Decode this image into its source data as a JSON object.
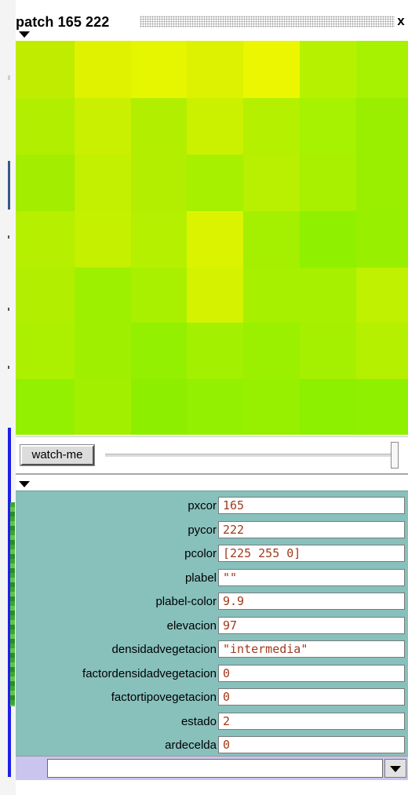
{
  "window": {
    "title": "patch 165 222",
    "close_symbol": "x",
    "icons": {
      "close": "close-icon",
      "view_toggle": "triangle-down-icon",
      "details_toggle": "triangle-down-icon",
      "dropdown": "chevron-down-icon"
    }
  },
  "view": {
    "patch_colors": [
      [
        "#c0ec00",
        "#e1f200",
        "#e6f500",
        "#ddf200",
        "#ecf600",
        "#b6f200",
        "#a6f200"
      ],
      [
        "#b2ee00",
        "#c9f000",
        "#b2ee00",
        "#cbf000",
        "#b5f000",
        "#a6f200",
        "#9aee00"
      ],
      [
        "#a2ed00",
        "#c3ef00",
        "#b3ee00",
        "#a6f000",
        "#b9ef00",
        "#a9f000",
        "#9aee00"
      ],
      [
        "#b6ef00",
        "#c5f000",
        "#b4f000",
        "#dcf300",
        "#a4f000",
        "#8ff000",
        "#98f000"
      ],
      [
        "#b1ee00",
        "#9df000",
        "#a9f000",
        "#d5f200",
        "#a6f000",
        "#a6f000",
        "#bff100"
      ],
      [
        "#acf000",
        "#9ef000",
        "#93f000",
        "#a3f000",
        "#9bf000",
        "#a4f000",
        "#b4f000"
      ],
      [
        "#93f000",
        "#a2f000",
        "#8eee00",
        "#92f000",
        "#97f000",
        "#8cf000",
        "#8ff000"
      ]
    ]
  },
  "controls": {
    "watch_me_label": "watch-me",
    "speed_value": 1.0
  },
  "variables": [
    {
      "name": "pxcor",
      "value": "165"
    },
    {
      "name": "pycor",
      "value": "222"
    },
    {
      "name": "pcolor",
      "value": "[225 255 0]"
    },
    {
      "name": "plabel",
      "value": "\"\""
    },
    {
      "name": "plabel-color",
      "value": "9.9"
    },
    {
      "name": "elevacion",
      "value": "97"
    },
    {
      "name": "densidadvegetacion",
      "value": "\"intermedia\""
    },
    {
      "name": "factordensidadvegetacion",
      "value": "0"
    },
    {
      "name": "factortipovegetacion",
      "value": "0"
    },
    {
      "name": "estado",
      "value": "2"
    },
    {
      "name": "ardecelda",
      "value": "0"
    }
  ],
  "command": {
    "value": ""
  }
}
